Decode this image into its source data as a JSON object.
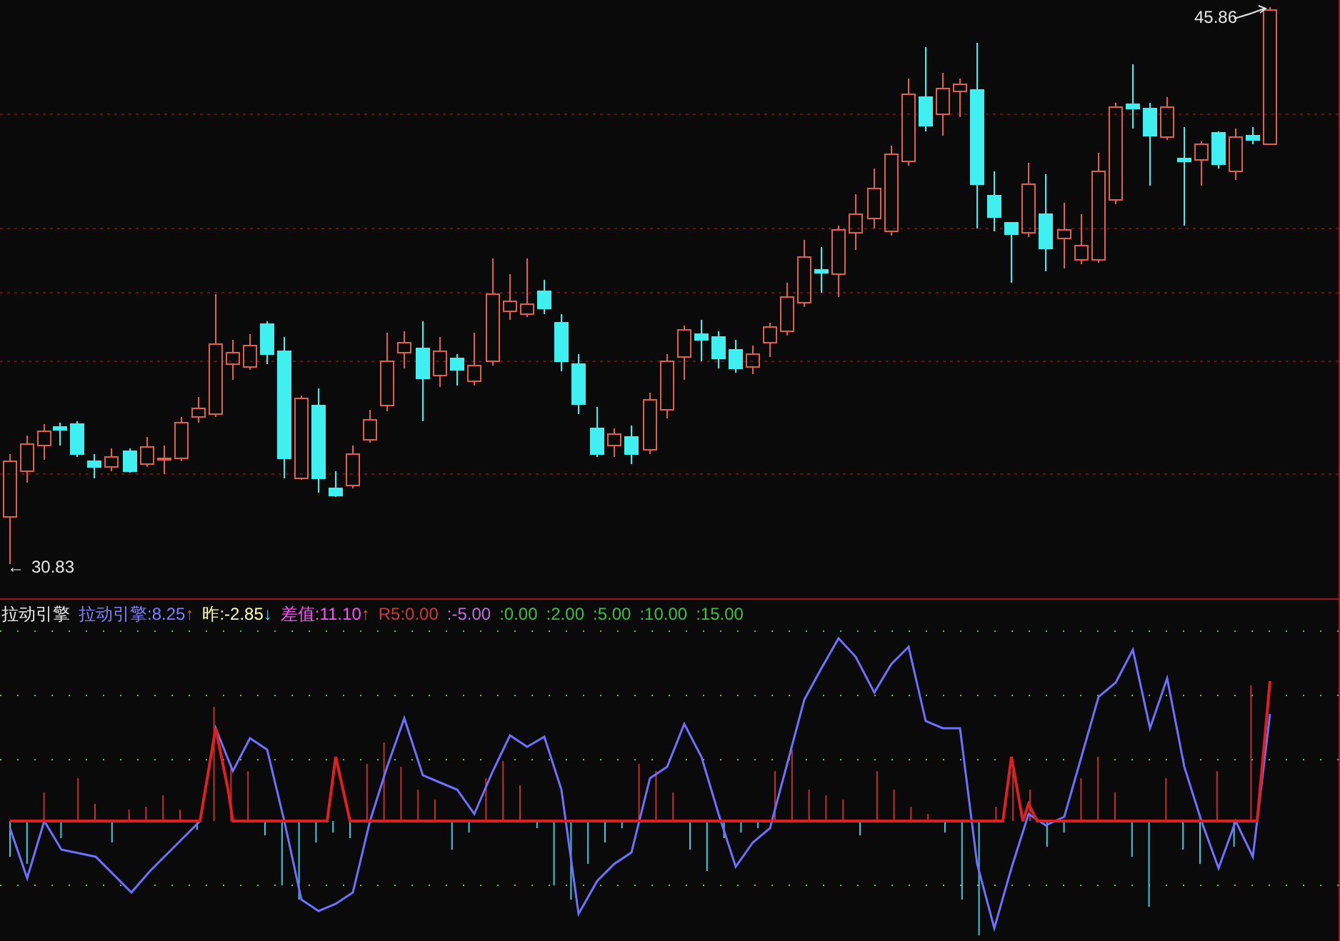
{
  "price_chart": {
    "high_label": "45.86",
    "low_label": {
      "arrow": "←",
      "value": "30.83"
    }
  },
  "indicator": {
    "title": "拉动引擎",
    "legend": [
      {
        "text": "拉动引擎:8.25",
        "color": "#8080ff",
        "arrow": {
          "glyph": "↑",
          "color": "#ff4040"
        }
      },
      {
        "text": "昨:-2.85",
        "color": "#ffffb0",
        "arrow": {
          "glyph": "↓",
          "color": "#40e0ff"
        }
      },
      {
        "text": "差值:11.10",
        "color": "#ff50ff",
        "arrow": {
          "glyph": "↑",
          "color": "#ff4040"
        }
      },
      {
        "text": "R5:0.00",
        "color": "#c83c3c"
      },
      {
        "text": ":-5.00",
        "color": "#c070e0"
      },
      {
        "text": ":0.00",
        "color": "#40c040"
      },
      {
        "text": ":2.00",
        "color": "#40c040"
      },
      {
        "text": ":5.00",
        "color": "#40c040"
      },
      {
        "text": ":10.00",
        "color": "#40c040"
      },
      {
        "text": ":15.00",
        "color": "#40c040"
      }
    ]
  }
}
